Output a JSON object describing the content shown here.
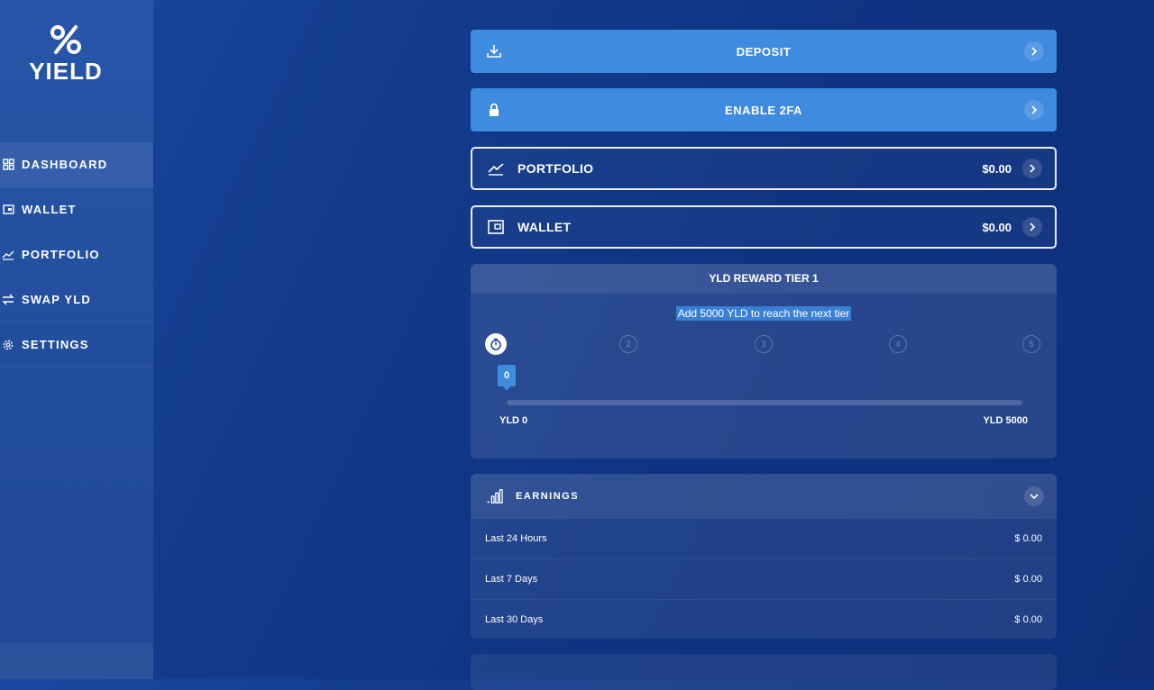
{
  "brand": {
    "name": "YIELD"
  },
  "sidebar": {
    "items": [
      {
        "label": "DASHBOARD",
        "icon": "dashboard-icon",
        "active": true
      },
      {
        "label": "WALLET",
        "icon": "wallet-icon",
        "active": false
      },
      {
        "label": "PORTFOLIO",
        "icon": "chart-line-icon",
        "active": false
      },
      {
        "label": "SWAP YLD",
        "icon": "swap-icon",
        "active": false
      },
      {
        "label": "SETTINGS",
        "icon": "gear-icon",
        "active": false
      }
    ]
  },
  "actions": {
    "deposit": {
      "label": "DEPOSIT",
      "icon": "download-icon"
    },
    "enable_2fa": {
      "label": "ENABLE 2FA",
      "icon": "lock-icon"
    }
  },
  "summary": {
    "portfolio": {
      "label": "PORTFOLIO",
      "amount": "$0.00"
    },
    "wallet": {
      "label": "WALLET",
      "amount": "$0.00"
    }
  },
  "reward_tier": {
    "title": "YLD REWARD TIER 1",
    "message": "Add 5000 YLD to reach the next tier",
    "steps": [
      "1",
      "2",
      "3",
      "4",
      "5"
    ],
    "current_step": 1,
    "marker_value": "0",
    "progress": 0,
    "min_label": "YLD 0",
    "max_label": "YLD 5000"
  },
  "earnings": {
    "title": "EARNINGS",
    "rows": [
      {
        "period": "Last 24 Hours",
        "amount": "$ 0.00"
      },
      {
        "period": "Last 7 Days",
        "amount": "$ 0.00"
      },
      {
        "period": "Last 30 Days",
        "amount": "$ 0.00"
      }
    ]
  },
  "colors": {
    "accent": "#3f8be0",
    "background": "#133b8c",
    "sidebar": "#234e9e"
  }
}
